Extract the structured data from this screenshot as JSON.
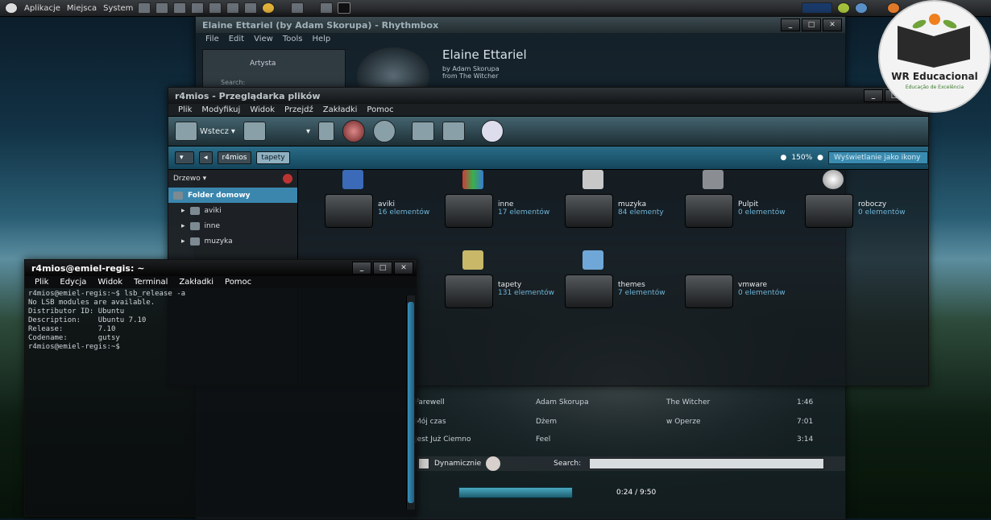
{
  "panel": {
    "menus": [
      "Aplikacje",
      "Miejsca",
      "System"
    ]
  },
  "rhythmbox": {
    "title": "Elaine Ettariel (by Adam Skorupa) - Rhythmbox",
    "menus": [
      "File",
      "Edit",
      "View",
      "Tools",
      "Help"
    ],
    "side_select": "Artysta",
    "search_label": "Search:",
    "now_title": "Elaine Ettariel",
    "now_by": "by Adam Skorupa",
    "now_from": "from The Witcher",
    "tracks": [
      {
        "title": "Farewell",
        "artist": "Adam Skorupa",
        "album": "The Witcher",
        "time": "1:46"
      },
      {
        "title": "Mój czas",
        "artist": "Dżem",
        "album": "w Operze",
        "time": "7:01"
      },
      {
        "title": "Jest Już Ciemno",
        "artist": "Feel",
        "album": "",
        "time": "3:14"
      }
    ],
    "dynamic_label": "Dynamicznie",
    "bottom_search": "Search:",
    "elapsed": "0:24 / 9:50"
  },
  "nautilus": {
    "title": "r4mios - Przeglądarka plików",
    "menus": [
      "Plik",
      "Modyfikuj",
      "Widok",
      "Przejdź",
      "Zakładki",
      "Pomoc"
    ],
    "back": "Wstecz",
    "crumbs": [
      "r4mios",
      "tapety"
    ],
    "zoom": "150%",
    "view": "Wyświetlanie jako ikony",
    "side_head": "Drzewo",
    "tree": [
      "Folder domowy",
      "aviki",
      "inne",
      "muzyka"
    ],
    "folders": [
      {
        "name": "aviki",
        "count": "16 elementów"
      },
      {
        "name": "inne",
        "count": "17 elementów"
      },
      {
        "name": "muzyka",
        "count": "84 elementy"
      },
      {
        "name": "Pulpit",
        "count": "0 elementów"
      },
      {
        "name": "roboczy",
        "count": "0 elementów"
      },
      {
        "name": "tapety",
        "count": "131 elementów"
      },
      {
        "name": "themes",
        "count": "7 elementów"
      },
      {
        "name": "vmware",
        "count": "0 elementów"
      }
    ]
  },
  "terminal": {
    "title": "r4mios@emiel-regis: ~",
    "menus": [
      "Plik",
      "Edycja",
      "Widok",
      "Terminal",
      "Zakładki",
      "Pomoc"
    ],
    "lines": [
      "r4mios@emiel-regis:~$ lsb_release -a",
      "No LSB modules are available.",
      "Distributor ID: Ubuntu",
      "Description:    Ubuntu 7.10",
      "Release:        7.10",
      "Codename:       gutsy",
      "r4mios@emiel-regis:~$"
    ]
  },
  "logo": {
    "brand": "WR Educacional",
    "tag": "Educação de Excelência"
  }
}
